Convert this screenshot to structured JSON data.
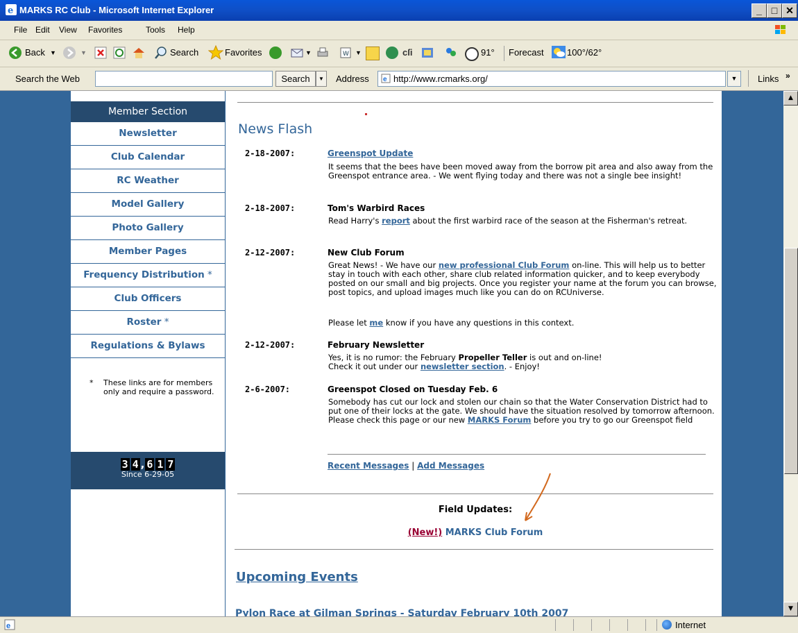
{
  "window": {
    "title": "MARKS RC Club - Microsoft Internet Explorer"
  },
  "menubar": [
    "File",
    "Edit",
    "View",
    "Favorites",
    "Tools",
    "Help"
  ],
  "toolbar": {
    "back": "Back",
    "search": "Search",
    "favorites": "Favorites",
    "temp": "91°",
    "forecast": "Forecast",
    "forecast_temp": "100°/62°"
  },
  "addressbar": {
    "search_web_label": "Search the Web",
    "search_button": "Search",
    "address_label": "Address",
    "url": "http://www.rcmarks.org/",
    "links_label": "Links"
  },
  "sidebar": {
    "header": "Member Section",
    "items": [
      {
        "label": "Newsletter",
        "star": ""
      },
      {
        "label": "Club Calendar",
        "star": ""
      },
      {
        "label": "RC Weather",
        "star": ""
      },
      {
        "label": "Model Gallery",
        "star": ""
      },
      {
        "label": "Photo Gallery",
        "star": ""
      },
      {
        "label": "Member Pages",
        "star": ""
      },
      {
        "label": "Frequency Distribution",
        "star": " *"
      },
      {
        "label": "Club Officers",
        "star": ""
      },
      {
        "label": "Roster",
        "star": " *"
      },
      {
        "label": "Regulations & Bylaws",
        "star": ""
      }
    ],
    "note_star": "*",
    "note": "These links are for members only and require a password.",
    "counter_digits": [
      "3",
      "4",
      ",",
      "6",
      "1",
      "7"
    ],
    "counter_since": "Since 6-29-05"
  },
  "news": {
    "heading": "News Flash",
    "items": [
      {
        "date": "2-18-2007:",
        "title": "Greenspot Update",
        "text": "It seems that the bees have been moved away from the borrow pit area and also away from the Greenspot entrance area. - We went flying today and there was not a single bee insight!"
      },
      {
        "date": "2-18-2007:",
        "title": "Tom's Warbird Races",
        "text_pre": "Read Harry's ",
        "link": "report",
        "text_post": " about the first warbird race of the season at the Fisherman's retreat."
      },
      {
        "date": "2-12-2007:",
        "title": "New Club Forum",
        "text_pre": "Great News! - We have our ",
        "link": "new professional Club Forum",
        "text_post": " on-line. This will help us to better stay in touch with each other, share club related information quicker, and to keep everybody posted on our small and big projects. Once you register your name at the forum you can browse, post topics, and upload images much like you can do on RCUniverse.",
        "text2_pre": "Please let ",
        "link2": "me",
        "text2_post": " know if you have any questions in this context."
      },
      {
        "date": "2-12-2007:",
        "title": "February Newsletter",
        "text_pre": "Yes, it is no rumor: the February ",
        "bold": "Propeller Teller",
        "text_mid": " is out and on-line!",
        "text2_pre": "Check it out under our ",
        "link2": "newsletter section",
        "text2_post": ". - Enjoy!"
      },
      {
        "date": "2-6-2007:",
        "title": "Greenspot Closed on Tuesday Feb. 6",
        "text_pre": "Somebody has cut our lock and stolen our chain so that the Water Conservation District had to put one of their locks at the gate. We should have the situation resolved by tomorrow afternoon. Please check this page or our new ",
        "link": "MARKS Forum",
        "text_post": " before you try to go our Greenspot field"
      }
    ],
    "recent_messages": "Recent Messages",
    "separator": "|",
    "add_messages": "Add Messages"
  },
  "field_updates": {
    "heading": "Field Updates:",
    "new_tag": "(New!)",
    "forum_link": "MARKS Club Forum"
  },
  "upcoming": {
    "heading": "Upcoming Events",
    "first_item": "Pylon Race at Gilman Springs - Saturday February 10th 2007"
  },
  "statusbar": {
    "zone": "Internet"
  },
  "colors": {
    "link": "#336699",
    "nav_dark": "#264a6e",
    "page_bg": "#336699",
    "new_tag": "#990033",
    "arrow": "#d2691e"
  }
}
